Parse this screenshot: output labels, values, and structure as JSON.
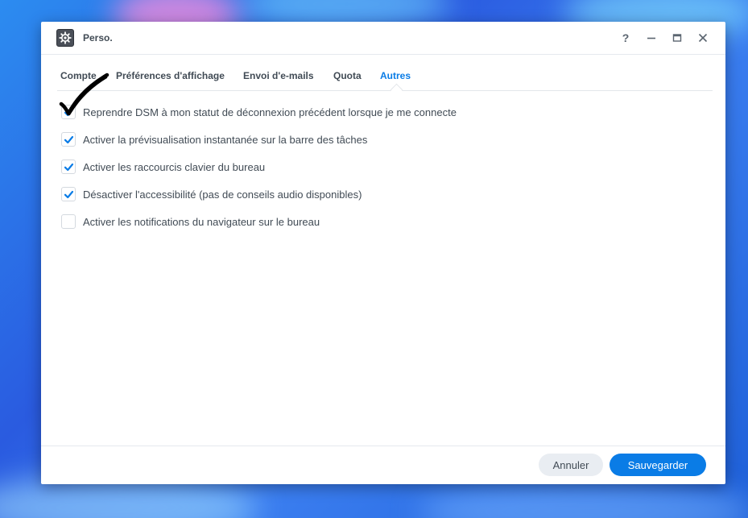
{
  "window": {
    "title": "Perso.",
    "app_icon": "gear-settings-icon",
    "controls": {
      "help_label": "?",
      "help_icon": "help-icon",
      "minimize_icon": "minimize-icon",
      "maximize_icon": "maximize-icon",
      "close_icon": "close-icon"
    }
  },
  "tabs": [
    {
      "label": "Compte",
      "active": false
    },
    {
      "label": "Préférences d'affichage",
      "active": false
    },
    {
      "label": "Envoi d'e-mails",
      "active": false
    },
    {
      "label": "Quota",
      "active": false
    },
    {
      "label": "Autres",
      "active": true
    }
  ],
  "options": [
    {
      "label": "Reprendre DSM à mon statut de déconnexion précédent lorsque je me connecte",
      "checked": true
    },
    {
      "label": "Activer la prévisualisation instantanée sur la barre des tâches",
      "checked": true
    },
    {
      "label": "Activer les raccourcis clavier du bureau",
      "checked": true
    },
    {
      "label": "Désactiver l'accessibilité (pas de conseils audio disponibles)",
      "checked": true
    },
    {
      "label": "Activer les notifications du navigateur sur le bureau",
      "checked": false
    }
  ],
  "footer": {
    "cancel_label": "Annuler",
    "save_label": "Sauvegarder"
  },
  "colors": {
    "accent": "#0a7ce6",
    "text": "#414b55",
    "cancel_bg": "#e9edf2"
  }
}
